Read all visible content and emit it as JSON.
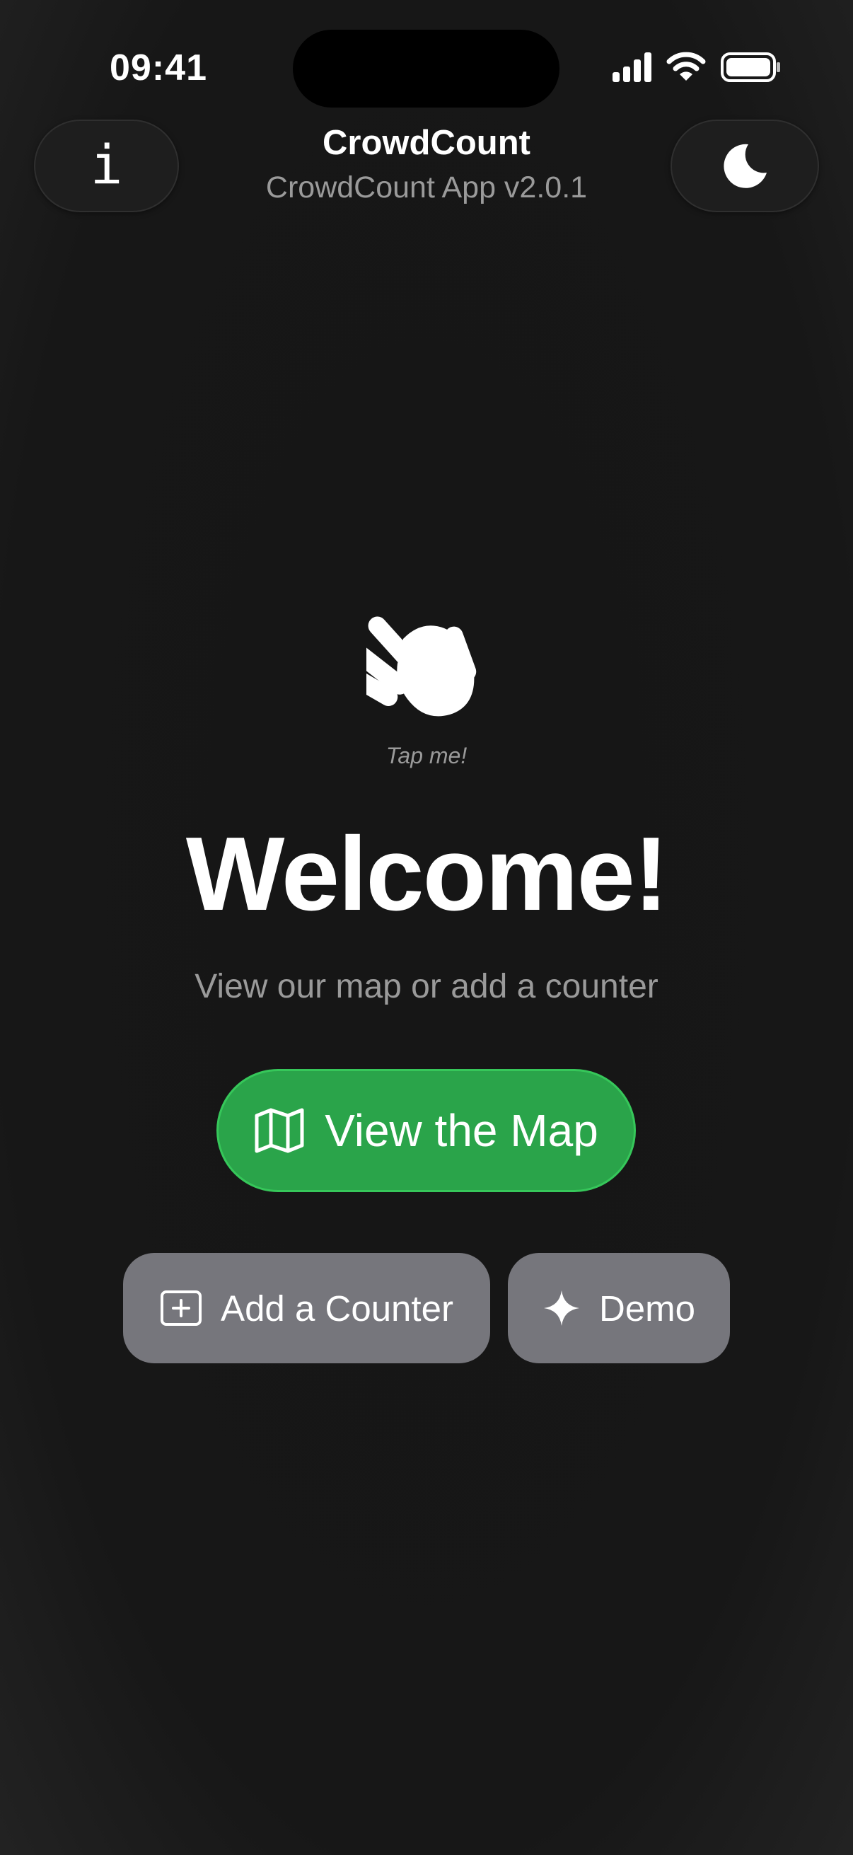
{
  "status_bar": {
    "time": "09:41",
    "icons": [
      "cellular-signal-icon",
      "wifi-icon",
      "battery-icon"
    ]
  },
  "header": {
    "title": "CrowdCount",
    "subtitle": "CrowdCount App v2.0.1",
    "info_button_glyph": "i",
    "info_icon": "info-icon",
    "theme_icon": "moon-icon"
  },
  "main": {
    "wave_icon": "waving-hand-icon",
    "tap_hint": "Tap me!",
    "welcome_title": "Welcome!",
    "welcome_subtitle": "View our map or add a counter",
    "map_button": {
      "label": "View the Map",
      "icon": "map-icon"
    },
    "add_counter_button": {
      "label": "Add a Counter",
      "icon": "plus-square-icon"
    },
    "demo_button": {
      "label": "Demo",
      "icon": "sparkle-icon"
    }
  },
  "colors": {
    "background": "#171717",
    "primary_green": "#2aa44a",
    "secondary_gray": "#76767c",
    "muted_text": "#9a9a9a"
  }
}
